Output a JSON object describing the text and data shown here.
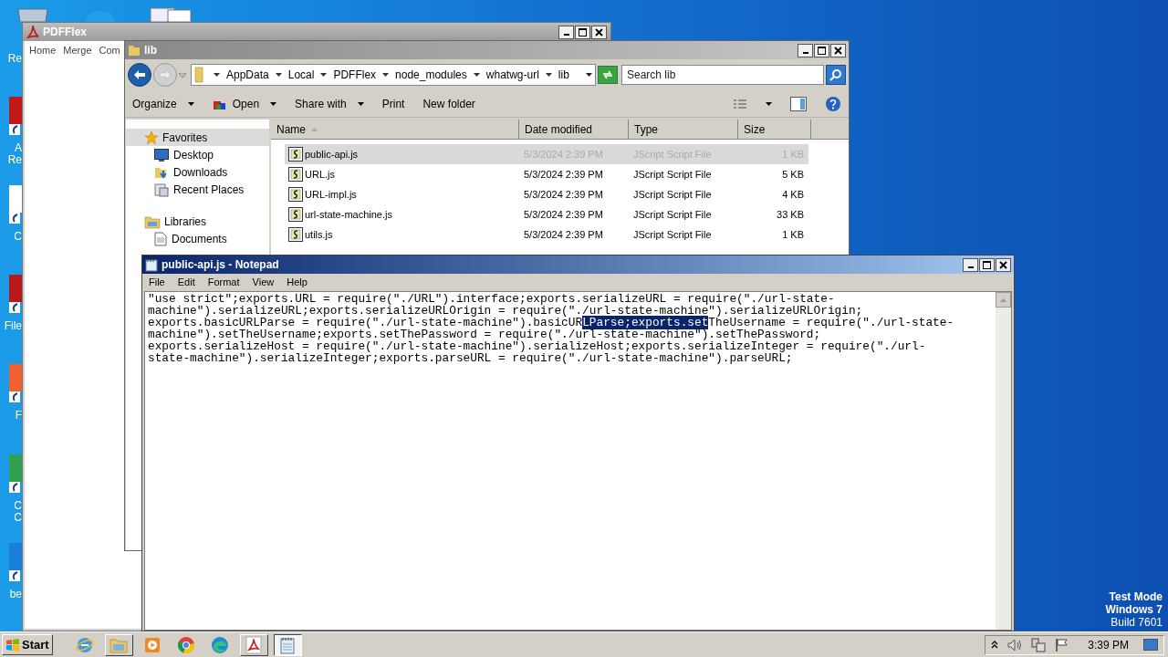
{
  "desktop": {
    "icons": [
      {
        "label": "Re"
      },
      {
        "label": "A\nRe"
      },
      {
        "label": "C"
      },
      {
        "label": "File"
      },
      {
        "label": "F"
      },
      {
        "label": "C\nC"
      },
      {
        "label": "be"
      }
    ],
    "os_notice": [
      "Test Mode",
      "Windows 7",
      "Build 7601"
    ]
  },
  "pdfflex": {
    "title": "PDFFlex",
    "menu": [
      "Home",
      "Merge",
      "Com"
    ]
  },
  "explorer": {
    "title": "lib",
    "breadcrumbs": [
      "AppData",
      "Local",
      "PDFFlex",
      "node_modules",
      "whatwg-url",
      "lib"
    ],
    "search": {
      "placeholder": "Search lib"
    },
    "toolbar": [
      {
        "label": "Organize",
        "dropdown": true,
        "kind": "text"
      },
      {
        "label": "Open",
        "dropdown": true,
        "kind": "open"
      },
      {
        "label": "Share with",
        "dropdown": true,
        "kind": "text"
      },
      {
        "label": "Print",
        "dropdown": false,
        "kind": "text"
      },
      {
        "label": "New folder",
        "dropdown": false,
        "kind": "text"
      }
    ],
    "nav": [
      {
        "label": "Favorites",
        "kind": "star",
        "selected": true,
        "children": [
          {
            "label": "Desktop",
            "kind": "desktop",
            "selected": false
          },
          {
            "label": "Downloads",
            "kind": "downloads",
            "selected": false
          },
          {
            "label": "Recent Places",
            "kind": "recent",
            "selected": false
          }
        ]
      },
      {
        "label": "Libraries",
        "kind": "library",
        "selected": false,
        "children": [
          {
            "label": "Documents",
            "kind": "document",
            "selected": false
          }
        ]
      }
    ],
    "columns": [
      {
        "label": "Name",
        "sorted": true
      },
      {
        "label": "Date modified",
        "sorted": false
      },
      {
        "label": "Type",
        "sorted": false
      },
      {
        "label": "Size",
        "sorted": false
      }
    ],
    "files": [
      {
        "name": "public-api.js",
        "date": "5/3/2024 2:39 PM",
        "type": "JScript Script File",
        "size": "1 KB",
        "selected": true
      },
      {
        "name": "URL.js",
        "date": "5/3/2024 2:39 PM",
        "type": "JScript Script File",
        "size": "5 KB",
        "selected": false
      },
      {
        "name": "URL-impl.js",
        "date": "5/3/2024 2:39 PM",
        "type": "JScript Script File",
        "size": "4 KB",
        "selected": false
      },
      {
        "name": "url-state-machine.js",
        "date": "5/3/2024 2:39 PM",
        "type": "JScript Script File",
        "size": "33 KB",
        "selected": false
      },
      {
        "name": "utils.js",
        "date": "5/3/2024 2:39 PM",
        "type": "JScript Script File",
        "size": "1 KB",
        "selected": false
      }
    ]
  },
  "notepad": {
    "title": "public-api.js - Notepad",
    "menu": [
      "File",
      "Edit",
      "Format",
      "View",
      "Help"
    ],
    "lines": [
      {
        "segments": [
          {
            "text": "\"use strict\";exports.URL = require(\"./URL\").interface;exports.serializeURL = require(\"./url-state-",
            "selected": false
          }
        ]
      },
      {
        "segments": [
          {
            "text": "machine\").serializeURL;exports.serializeURLOrigin = require(\"./url-state-machine\").serializeURLOrigin;",
            "selected": false
          }
        ]
      },
      {
        "segments": [
          {
            "text": "exports.basicURLParse = require(\"./url-state-machine\").basicUR",
            "selected": false
          },
          {
            "text": "LParse;exports.set",
            "selected": true
          },
          {
            "text": "TheUsername = require(\"./url-state-",
            "selected": false
          }
        ]
      },
      {
        "segments": [
          {
            "text": "machine\").setTheUsername;exports.setThePassword = require(\"./url-state-machine\").setThePassword;",
            "selected": false
          }
        ]
      },
      {
        "segments": [
          {
            "text": "exports.serializeHost = require(\"./url-state-machine\").serializeHost;exports.serializeInteger = require(\"./url-",
            "selected": false
          }
        ]
      },
      {
        "segments": [
          {
            "text": "state-machine\").serializeInteger;exports.parseURL = require(\"./url-state-machine\").parseURL;",
            "selected": false
          }
        ]
      }
    ]
  },
  "taskbar": {
    "start": "Start",
    "apps": [
      {
        "kind": "ie",
        "running": false,
        "active": false
      },
      {
        "kind": "explorer",
        "running": true,
        "active": false
      },
      {
        "kind": "media",
        "running": false,
        "active": false
      },
      {
        "kind": "chrome",
        "running": false,
        "active": false
      },
      {
        "kind": "edge",
        "running": false,
        "active": false
      },
      {
        "kind": "pdf",
        "running": true,
        "active": false
      },
      {
        "kind": "notepad",
        "running": true,
        "active": true
      }
    ],
    "clock": "3:39 PM"
  }
}
